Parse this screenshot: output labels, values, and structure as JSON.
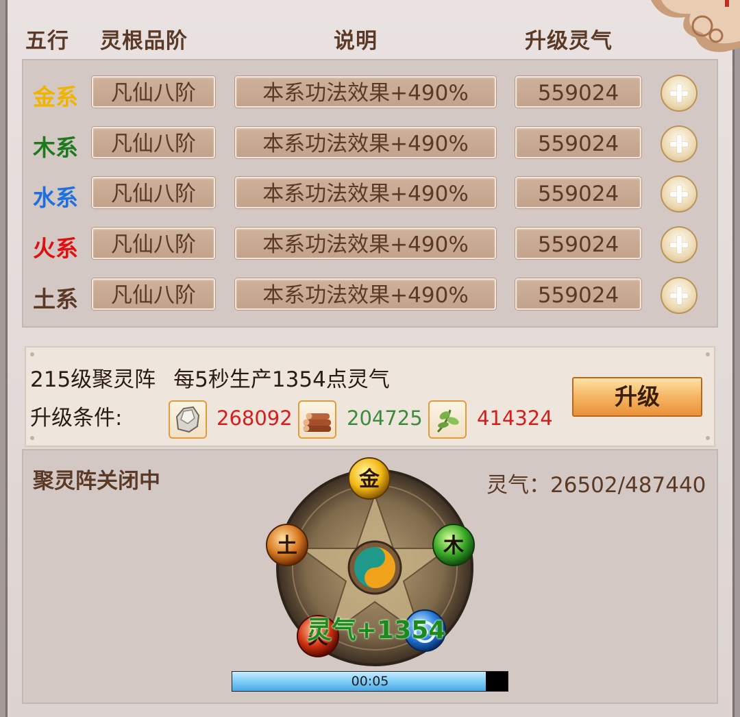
{
  "header": {
    "col_element": "五行",
    "col_grade": "灵根品阶",
    "col_desc": "说明",
    "col_cost": "升级灵气"
  },
  "rows": [
    {
      "name": "金系",
      "color": "#f0b400",
      "grade": "凡仙八阶",
      "desc": "本系功法效果+490%",
      "cost": "559024"
    },
    {
      "name": "木系",
      "color": "#1f7a1f",
      "grade": "凡仙八阶",
      "desc": "本系功法效果+490%",
      "cost": "559024"
    },
    {
      "name": "水系",
      "color": "#1e6fe0",
      "grade": "凡仙八阶",
      "desc": "本系功法效果+490%",
      "cost": "559024"
    },
    {
      "name": "火系",
      "color": "#e01010",
      "grade": "凡仙八阶",
      "desc": "本系功法效果+490%",
      "cost": "559024"
    },
    {
      "name": "土系",
      "color": "#5a3a26",
      "grade": "凡仙八阶",
      "desc": "本系功法效果+490%",
      "cost": "559024"
    }
  ],
  "array": {
    "level_text": "215级聚灵阵",
    "production_text": "每5秒生产1354点灵气",
    "condition_label": "升级条件:",
    "upgrade_label": "升级",
    "resources": [
      {
        "icon": "crystal-ore-icon",
        "value": "268092",
        "color": "#d81d1d"
      },
      {
        "icon": "wood-logs-icon",
        "value": "204725",
        "color": "#3d8a3d"
      },
      {
        "icon": "herb-leaf-icon",
        "value": "414324",
        "color": "#d81d1d"
      }
    ]
  },
  "formation": {
    "status": "聚灵阵关闭中",
    "lingqi_label": "灵气：",
    "lingqi_value": "26502/487440",
    "gain_text": "灵气+1354",
    "orbs": {
      "metal": "金",
      "wood": "木",
      "earth": "土",
      "fire": "火"
    },
    "timer": "00:05",
    "progress": 0.92
  }
}
